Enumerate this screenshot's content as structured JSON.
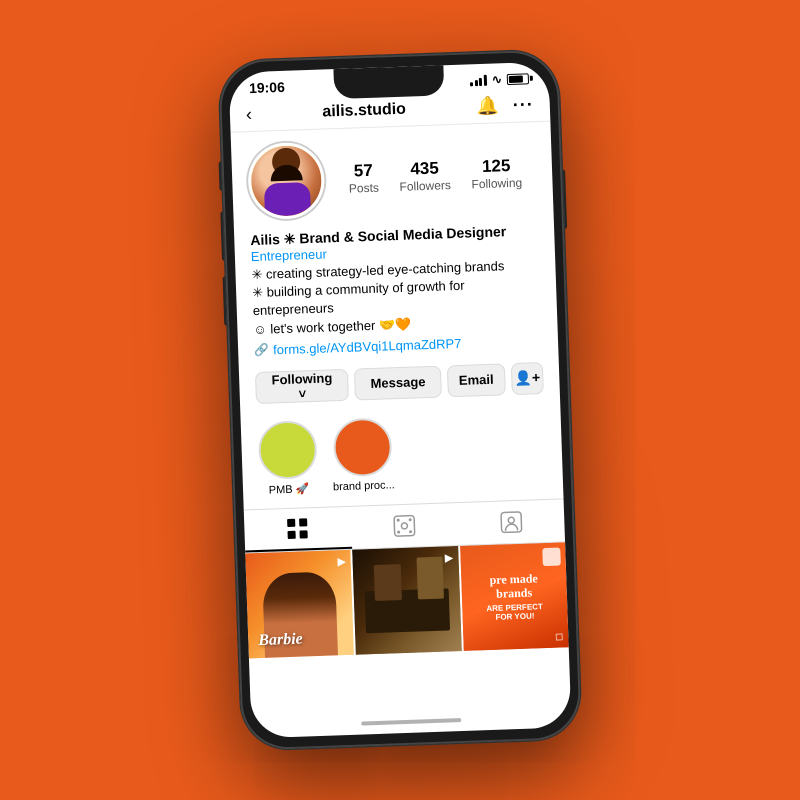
{
  "background": "#E85A1B",
  "phone": {
    "statusBar": {
      "time": "19:06"
    },
    "navBar": {
      "title": "ailis.studio",
      "backIcon": "‹",
      "bellIcon": "🔔",
      "moreIcon": "···"
    },
    "profile": {
      "username": "ailis.studio",
      "name": "Ailis ✳ Brand & Social Media Designer",
      "category": "Entrepreneur",
      "bio": [
        "✳ creating strategy-led eye-catching brands",
        "✳ building a community of growth for entrepreneurs",
        "☺ let's work together 🤝🧡"
      ],
      "link": "forms.gle/AYdBVqi1LqmaZdRP7",
      "stats": {
        "posts": {
          "number": "57",
          "label": "Posts"
        },
        "followers": {
          "number": "435",
          "label": "Followers"
        },
        "following": {
          "number": "125",
          "label": "Following"
        }
      },
      "buttons": {
        "following": "Following ˅",
        "message": "Message",
        "email": "Email",
        "addFriend": "+"
      },
      "highlights": [
        {
          "label": "PMB 🚀",
          "color": "#c8d93a"
        },
        {
          "label": "brand proc...",
          "color": "#E85A1B"
        }
      ]
    },
    "grid": {
      "items": [
        {
          "type": "barbie",
          "text": "Barbie"
        },
        {
          "type": "room"
        },
        {
          "type": "pmb",
          "line1": "pre made brands",
          "line2": "ARE PERFECT FOR YOU!"
        }
      ]
    }
  }
}
